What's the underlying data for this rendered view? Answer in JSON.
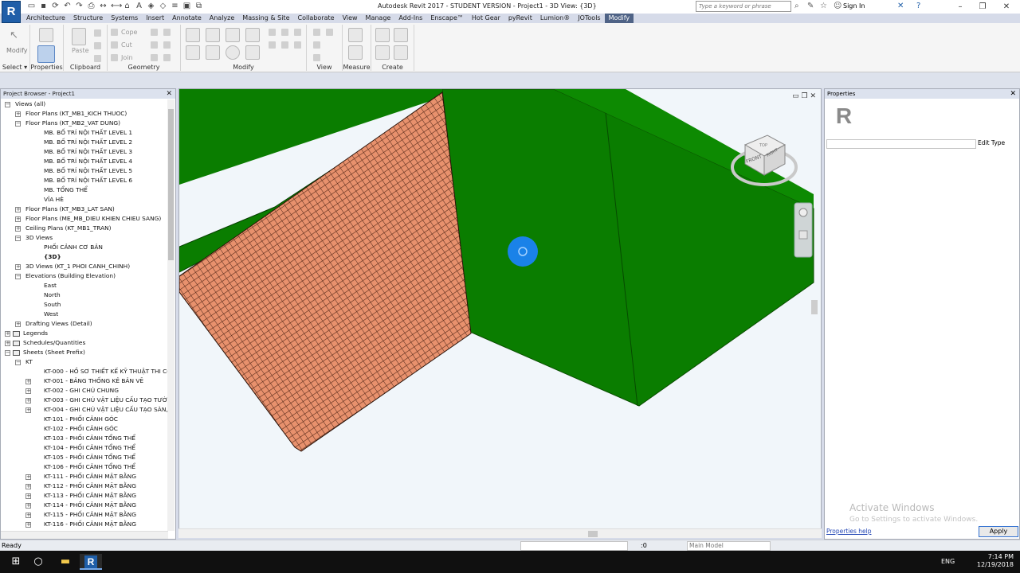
{
  "app": {
    "logo": "R",
    "title": "Autodesk Revit 2017 - STUDENT VERSION -    Project1 - 3D View: {3D}",
    "search_placeholder": "Type a keyword or phrase",
    "signin": "Sign In"
  },
  "menu": [
    "Architecture",
    "Structure",
    "Systems",
    "Insert",
    "Annotate",
    "Analyze",
    "Massing & Site",
    "Collaborate",
    "View",
    "Manage",
    "Add-Ins",
    "Enscape™",
    "Hot Gear",
    "pyRevit",
    "Lumion®",
    "JOTools",
    "Modify"
  ],
  "menu_active": "Modify",
  "ribbon": {
    "panels": [
      "Select ▾",
      "Properties",
      "Clipboard",
      "Geometry",
      "Modify",
      "View",
      "Measure",
      "Create"
    ],
    "modify_label": "Modify",
    "paste_label": "Paste",
    "cope_label": "Cope",
    "cut_label": "Cut",
    "join_label": "Join"
  },
  "project_browser": {
    "title": "Project Browser - Project1",
    "items": [
      {
        "label": "Views (all)",
        "indent": 0,
        "exp": "−"
      },
      {
        "label": "Floor Plans (KT_MB1_KICH THUOC)",
        "indent": 1,
        "exp": "+"
      },
      {
        "label": "Floor Plans (KT_MB2_VAT DUNG)",
        "indent": 1,
        "exp": "−"
      },
      {
        "label": "MB. BỐ TRÍ NỘI THẤT LEVEL 1",
        "indent": 2,
        "exp": ""
      },
      {
        "label": "MB. BỐ TRÍ NỘI THẤT LEVEL 2",
        "indent": 2,
        "exp": ""
      },
      {
        "label": "MB. BỐ TRÍ NỘI THẤT LEVEL 3",
        "indent": 2,
        "exp": ""
      },
      {
        "label": "MB. BỐ TRÍ NỘI THẤT LEVEL 4",
        "indent": 2,
        "exp": ""
      },
      {
        "label": "MB. BỐ TRÍ NỘI THẤT LEVEL 5",
        "indent": 2,
        "exp": ""
      },
      {
        "label": "MB. BỐ TRÍ NỘI THẤT LEVEL 6",
        "indent": 2,
        "exp": ""
      },
      {
        "label": "MB. TỔNG THỂ",
        "indent": 2,
        "exp": ""
      },
      {
        "label": "VỈA HÈ",
        "indent": 2,
        "exp": ""
      },
      {
        "label": "Floor Plans (KT_MB3_LAT SAN)",
        "indent": 1,
        "exp": "+"
      },
      {
        "label": "Floor Plans (ME_MB_DIEU KHIEN CHIEU SANG)",
        "indent": 1,
        "exp": "+"
      },
      {
        "label": "Ceiling Plans (KT_MB1_TRAN)",
        "indent": 1,
        "exp": "+"
      },
      {
        "label": "3D Views",
        "indent": 1,
        "exp": "−"
      },
      {
        "label": "PHỐI CẢNH CƠ BẢN",
        "indent": 2,
        "exp": ""
      },
      {
        "label": "{3D}",
        "indent": 2,
        "exp": "",
        "bold": true
      },
      {
        "label": "3D Views (KT_1 PHOI CANH_CHINH)",
        "indent": 1,
        "exp": "+"
      },
      {
        "label": "Elevations (Building Elevation)",
        "indent": 1,
        "exp": "−"
      },
      {
        "label": "East",
        "indent": 2,
        "exp": ""
      },
      {
        "label": "North",
        "indent": 2,
        "exp": ""
      },
      {
        "label": "South",
        "indent": 2,
        "exp": ""
      },
      {
        "label": "West",
        "indent": 2,
        "exp": ""
      },
      {
        "label": "Drafting Views (Detail)",
        "indent": 1,
        "exp": "+"
      },
      {
        "label": "Legends",
        "indent": 0,
        "exp": "+"
      },
      {
        "label": "Schedules/Quantities",
        "indent": 0,
        "exp": "+"
      },
      {
        "label": "Sheets (Sheet Prefix)",
        "indent": 0,
        "exp": "−"
      },
      {
        "label": "KT",
        "indent": 1,
        "exp": "−"
      },
      {
        "label": "KT-000 - HỒ SƠ THIẾT KẾ KỸ THUẬT THI CÔNG",
        "indent": 2,
        "exp": ""
      },
      {
        "label": "KT-001 - BẢNG THỐNG KÊ BẢN VẼ",
        "indent": 2,
        "exp": "+"
      },
      {
        "label": "KT-002 - GHI CHÚ CHUNG",
        "indent": 2,
        "exp": "+"
      },
      {
        "label": "KT-003 - GHI CHÚ VẬT LIỆU CẤU TẠO TƯỜNG",
        "indent": 2,
        "exp": "+"
      },
      {
        "label": "KT-004 - GHI CHÚ VẬT LIỆU CẤU TẠO SÀN, TRẦN",
        "indent": 2,
        "exp": "+"
      },
      {
        "label": "KT-101 - PHỐI CẢNH GÓC",
        "indent": 2,
        "exp": ""
      },
      {
        "label": "KT-102 - PHỐI CẢNH GÓC",
        "indent": 2,
        "exp": ""
      },
      {
        "label": "KT-103 - PHỐI CẢNH TỔNG THỂ",
        "indent": 2,
        "exp": ""
      },
      {
        "label": "KT-104 - PHỐI CẢNH TỔNG THỂ",
        "indent": 2,
        "exp": ""
      },
      {
        "label": "KT-105 - PHỐI CẢNH TỔNG THỂ",
        "indent": 2,
        "exp": ""
      },
      {
        "label": "KT-106 - PHỐI CẢNH TỔNG THỂ",
        "indent": 2,
        "exp": ""
      },
      {
        "label": "KT-111 - PHỐI CẢNH MẶT BẰNG",
        "indent": 2,
        "exp": "+"
      },
      {
        "label": "KT-112 - PHỐI CẢNH MẶT BẰNG",
        "indent": 2,
        "exp": "+"
      },
      {
        "label": "KT-113 - PHỐI CẢNH MẶT BẰNG",
        "indent": 2,
        "exp": "+"
      },
      {
        "label": "KT-114 - PHỐI CẢNH MẶT BẰNG",
        "indent": 2,
        "exp": "+"
      },
      {
        "label": "KT-115 - PHỐI CẢNH MẶT BẰNG",
        "indent": 2,
        "exp": "+"
      },
      {
        "label": "KT-116 - PHỐI CẢNH MẶT BẰNG",
        "indent": 2,
        "exp": "+"
      }
    ]
  },
  "viewcube": {
    "top": "TOP",
    "front": "FRONT",
    "right": "RIGHT"
  },
  "properties": {
    "title": "Properties",
    "logo": "R",
    "edit_type": "Edit Type",
    "help_link": "Properties help",
    "apply": "Apply"
  },
  "watermark": {
    "line1": "Activate Windows",
    "line2": "Go to Settings to activate Windows."
  },
  "status": {
    "text": "Ready",
    "zero": ":0",
    "model": "Main Model"
  },
  "taskbar": {
    "lang": "ENG",
    "time": "7:14 PM",
    "date": "12/19/2018"
  },
  "colors": {
    "green": "#0a7d00",
    "roof": "#e8916d",
    "roofline": "#3a1a10",
    "cursor": "#1a82e8"
  }
}
